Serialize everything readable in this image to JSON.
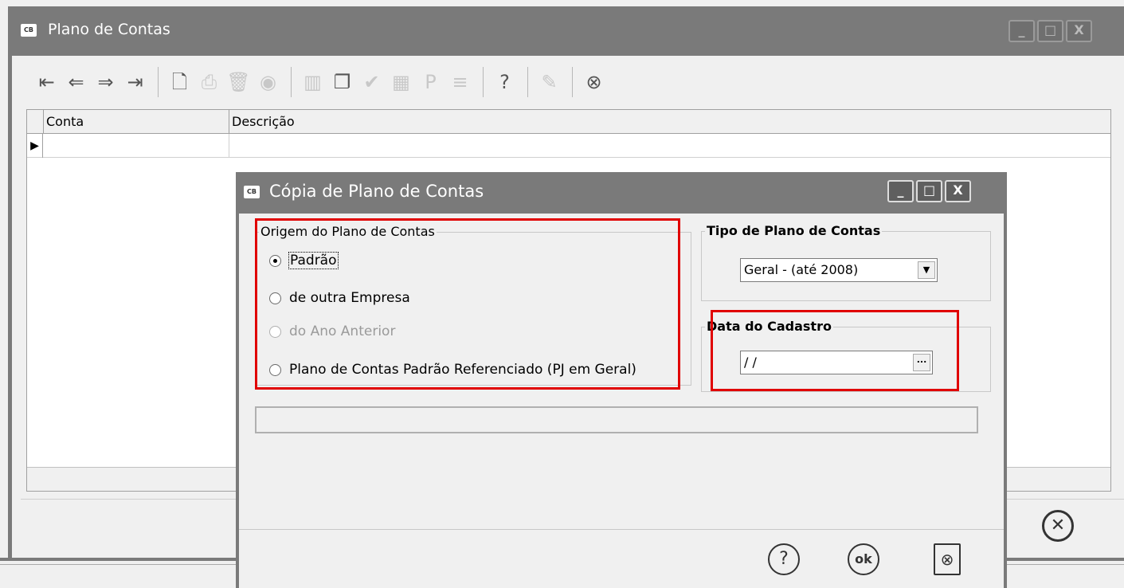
{
  "main_window": {
    "logo": "CB",
    "title": "Plano de Contas",
    "minimize": "_",
    "maximize": "□",
    "close": "X"
  },
  "toolbar": {
    "icons": [
      "first-record-icon",
      "previous-record-icon",
      "next-record-icon",
      "last-record-icon",
      "new-document-icon",
      "print-icon",
      "delete-icon",
      "view-icon",
      "delete-all-icon",
      "copy-icon",
      "confirm-icon",
      "chart-icon",
      "p-icon",
      "list-check-icon",
      "help-icon",
      "edit-icon",
      "close-icon"
    ]
  },
  "grid": {
    "columns": [
      "Conta",
      "Descrição"
    ]
  },
  "dialog": {
    "logo": "CB",
    "title": "Cópia de Plano de Contas",
    "origem": {
      "legend": "Origem do Plano de Contas",
      "options": [
        "Padrão",
        "de outra Empresa",
        "do Ano Anterior",
        "Plano de Contas Padrão Referenciado (PJ em Geral)"
      ],
      "selected": "Padrão"
    },
    "tipo": {
      "legend": "Tipo de Plano de Contas",
      "value": "Geral - (até 2008)"
    },
    "data": {
      "legend": "Data do Cadastro",
      "value": "/ /",
      "button": "..."
    },
    "footer": {
      "help": "?",
      "ok": "ok"
    }
  }
}
